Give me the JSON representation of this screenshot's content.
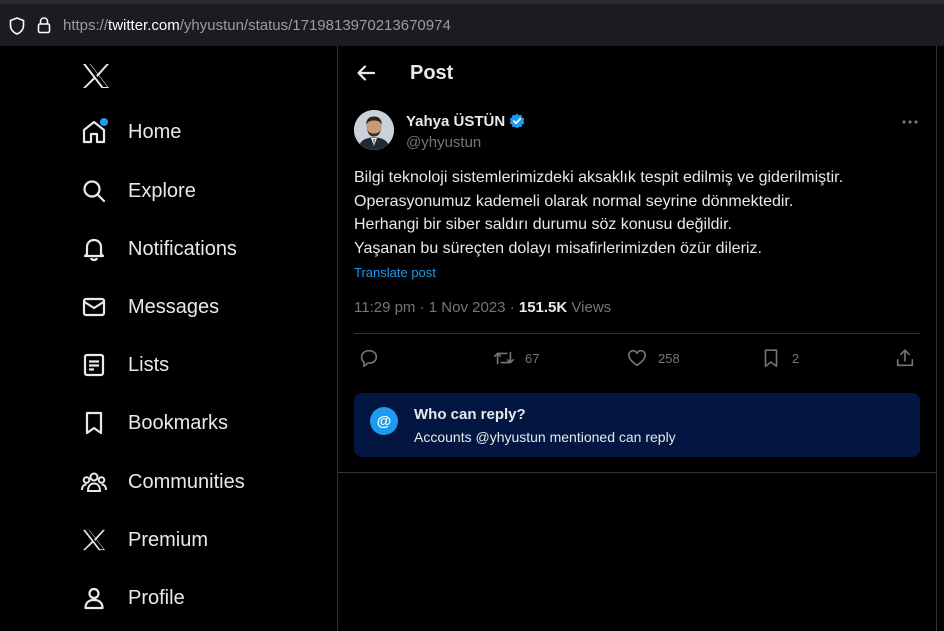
{
  "browser": {
    "url_prefix": "https://",
    "url_host": "twitter.com",
    "url_path": "/yhyustun/status/1719813970213670974"
  },
  "sidebar": {
    "items": [
      {
        "label": "Home",
        "icon": "home-icon"
      },
      {
        "label": "Explore",
        "icon": "search-icon"
      },
      {
        "label": "Notifications",
        "icon": "bell-icon"
      },
      {
        "label": "Messages",
        "icon": "envelope-icon"
      },
      {
        "label": "Lists",
        "icon": "list-icon"
      },
      {
        "label": "Bookmarks",
        "icon": "bookmark-icon"
      },
      {
        "label": "Communities",
        "icon": "people-icon"
      },
      {
        "label": "Premium",
        "icon": "x-logo-icon"
      },
      {
        "label": "Profile",
        "icon": "person-icon"
      }
    ]
  },
  "header": {
    "title": "Post"
  },
  "tweet": {
    "author_name": "Yahya ÜSTÜN",
    "handle": "@yhyustun",
    "lines": [
      "Bilgi teknoloji sistemlerimizdeki aksaklık tespit edilmiş ve giderilmiştir.",
      "Operasyonumuz kademeli olarak normal seyrine dönmektedir.",
      "Herhangi bir siber saldırı durumu söz konusu değildir.",
      "Yaşanan bu süreçten dolayı misafirlerimizden özür dileriz."
    ],
    "translate_label": "Translate post",
    "time": "11:29 pm",
    "date": "1 Nov 2023",
    "separator": "·",
    "views_count": "151.5K",
    "views_label": "Views"
  },
  "actions": {
    "reposts": "67",
    "likes": "258",
    "bookmarks": "2"
  },
  "reply_info": {
    "icon_char": "@",
    "title": "Who can reply?",
    "subtitle": "Accounts @yhyustun mentioned can reply"
  },
  "colors": {
    "accent": "#1d9bf0",
    "background": "#000000",
    "text": "#e7e9ea",
    "muted": "#71767b",
    "reply_box": "#031642"
  }
}
